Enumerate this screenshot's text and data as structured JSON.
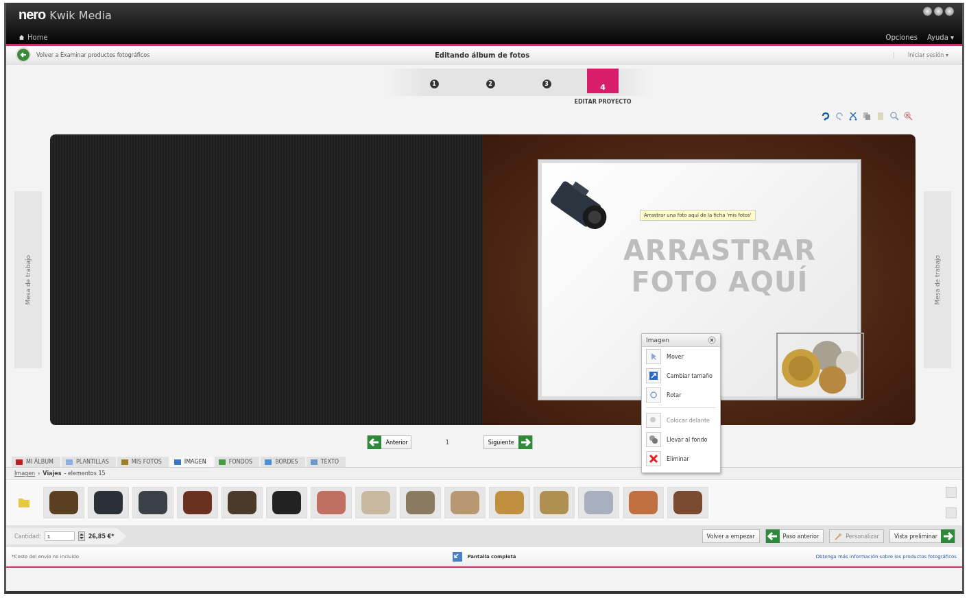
{
  "header": {
    "logo": "nero",
    "product": "Kwik Media",
    "home": "Home",
    "menus": [
      "Opciones",
      "Ayuda ▾"
    ]
  },
  "subbar": {
    "back_link": "Volver a Examinar productos fotográficos",
    "title": "Editando álbum de fotos",
    "login": "Iniciar sesión ▾"
  },
  "steps": [
    {
      "number": "1",
      "selected": false
    },
    {
      "number": "2",
      "selected": false
    },
    {
      "number": "3",
      "selected": false
    },
    {
      "number": "4",
      "selected": true,
      "label": "EDITAR PROYECTO"
    }
  ],
  "side_panels": [
    "Mesa de trabajo",
    "Mesa de trabajo"
  ],
  "album": {
    "drop_text": [
      "ARRASTRAR",
      "FOTO AQUÍ"
    ],
    "tooltip": "Arrastrar una foto aquí de la ficha 'mis fotos'"
  },
  "context_menu": {
    "title": "Imagen",
    "items": [
      {
        "label": "Mover",
        "kind": "move",
        "disabled": false
      },
      {
        "label": "Cambiar tamaño",
        "kind": "resize",
        "disabled": false
      },
      {
        "label": "Rotar",
        "kind": "rotate",
        "disabled": false
      },
      {
        "label": "Colocar delante",
        "kind": "front",
        "disabled": true
      },
      {
        "label": "Llevar al fondo",
        "kind": "back",
        "disabled": false
      },
      {
        "label": "Eliminar",
        "kind": "delete",
        "disabled": false
      }
    ]
  },
  "pager": {
    "previous": "Anterior",
    "page": "1",
    "next": "Siguiente"
  },
  "tabs": [
    {
      "label": "MI ÁLBUM",
      "kind": "album",
      "selected": false
    },
    {
      "label": "PLANTILLAS",
      "kind": "templates",
      "selected": false
    },
    {
      "label": "MIS FOTOS",
      "kind": "photos",
      "selected": false
    },
    {
      "label": "IMAGEN",
      "kind": "image",
      "selected": true
    },
    {
      "label": "FONDOS",
      "kind": "backgrounds",
      "selected": false
    },
    {
      "label": "BORDES",
      "kind": "borders",
      "selected": false
    },
    {
      "label": "TEXTO",
      "kind": "text",
      "selected": false
    }
  ],
  "breadcrumb": {
    "root": "Imagen",
    "separator": "›",
    "folder": "Viajes",
    "count": "- elementos 15"
  },
  "thumbnails": [
    {
      "color": "#5a4020"
    },
    {
      "color": "#2a3038"
    },
    {
      "color": "#3a3f48"
    },
    {
      "color": "#6a3020"
    },
    {
      "color": "#4a3a2a"
    },
    {
      "color": "#222222"
    },
    {
      "color": "#c07060"
    },
    {
      "color": "#c8b8a0"
    },
    {
      "color": "#8a7a60"
    },
    {
      "color": "#b89870"
    },
    {
      "color": "#c09040"
    },
    {
      "color": "#b09050"
    },
    {
      "color": "#a8b0c0"
    },
    {
      "color": "#c07040"
    },
    {
      "color": "#7a4a30"
    }
  ],
  "order": {
    "quantity_label": "Cantidad:",
    "quantity": "1",
    "price": "26,85 €*"
  },
  "actions": [
    {
      "label": "Volver a empezar",
      "kind": "plain",
      "disabled": false
    },
    {
      "label": "Paso anterior",
      "kind": "back",
      "disabled": false
    },
    {
      "label": "Personalizar",
      "kind": "tool",
      "disabled": true
    },
    {
      "label": "Vista preliminar",
      "kind": "next",
      "disabled": false
    }
  ],
  "status_bar": {
    "note": "*Coste del envío no incluido",
    "fullscreen": "Pantalla completa",
    "info_link": "Obtenga más información sobre los productos fotográficos"
  }
}
